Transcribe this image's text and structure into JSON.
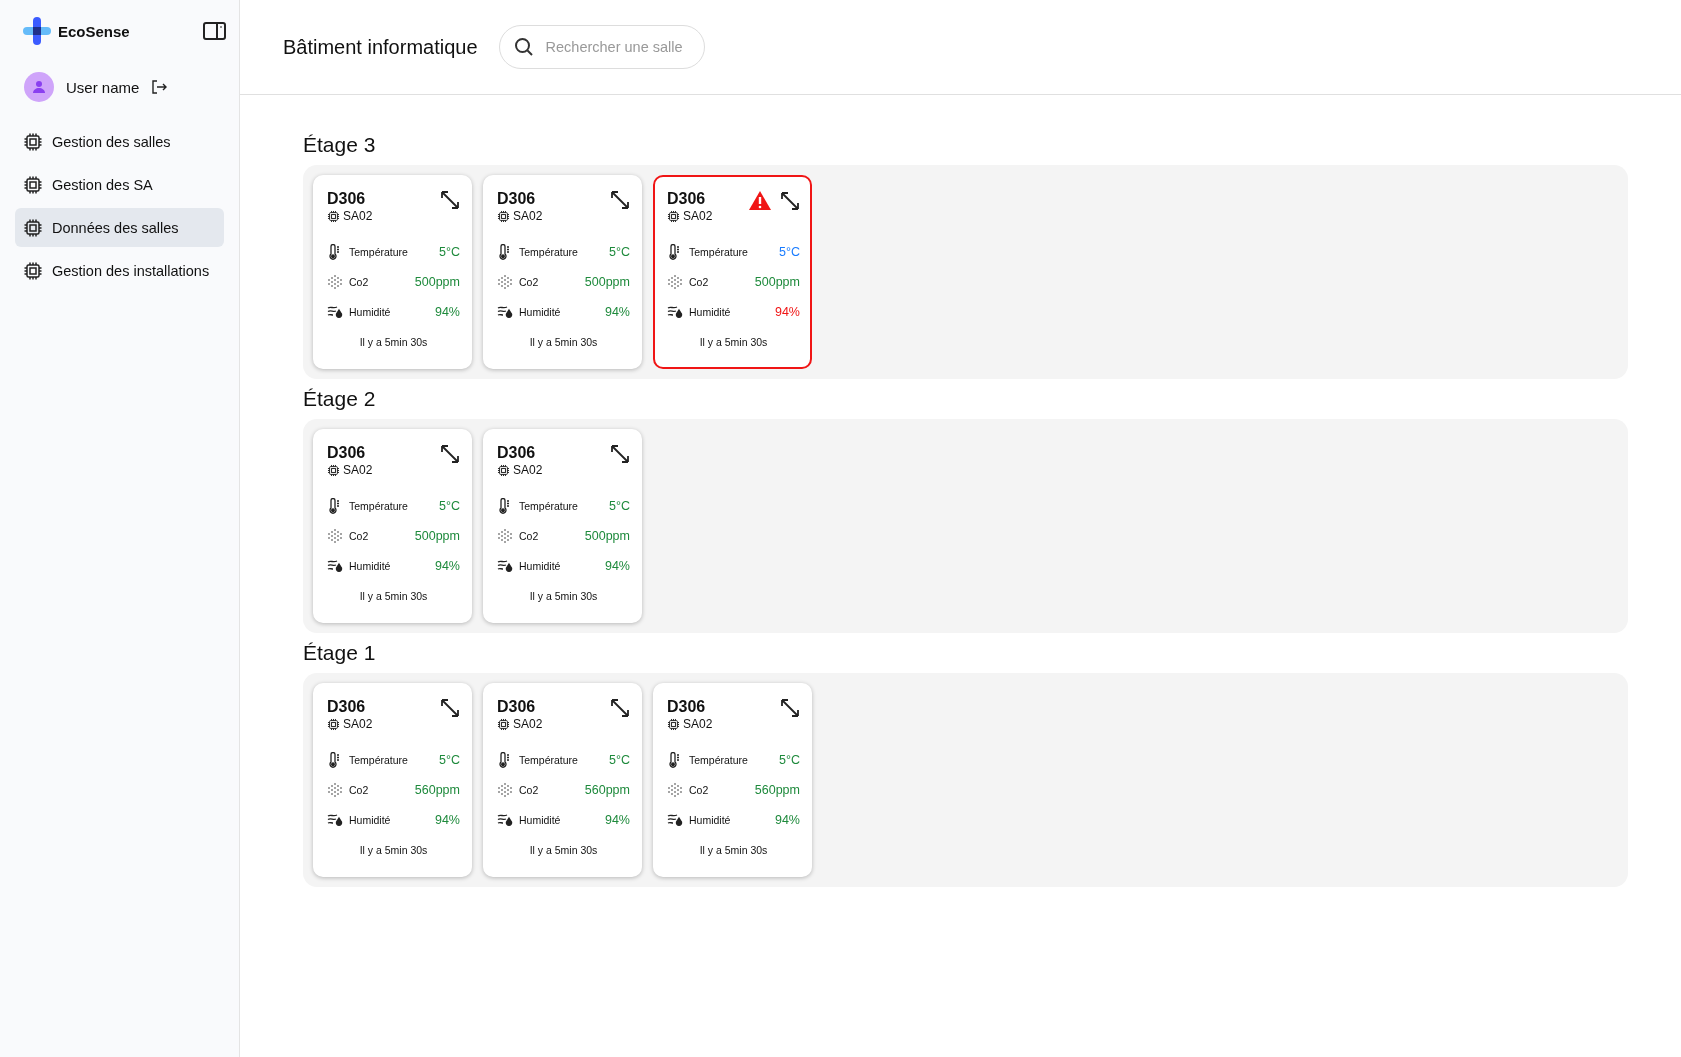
{
  "app": {
    "name": "EcoSense"
  },
  "user": {
    "name": "User name"
  },
  "nav": [
    {
      "label": "Gestion des salles",
      "selected": false
    },
    {
      "label": "Gestion des SA",
      "selected": false
    },
    {
      "label": "Données des salles",
      "selected": true
    },
    {
      "label": "Gestion des installations",
      "selected": false
    }
  ],
  "header": {
    "title": "Bâtiment informatique",
    "search": {
      "placeholder": "Rechercher une salle"
    }
  },
  "floors": [
    {
      "title": "Étage 3",
      "rooms": [
        {
          "name": "D306",
          "device": "SA02",
          "alert": false,
          "updated": "Il y a 5min 30s",
          "metrics": [
            {
              "kind": "temperature",
              "label": "Température",
              "value": "5°C",
              "color": "#1e8a3c"
            },
            {
              "kind": "co2",
              "label": "Co2",
              "value": "500ppm",
              "color": "#1e8a3c"
            },
            {
              "kind": "humidity",
              "label": "Humidité",
              "value": "94%",
              "color": "#1e8a3c"
            }
          ]
        },
        {
          "name": "D306",
          "device": "SA02",
          "alert": false,
          "updated": "Il y a 5min 30s",
          "metrics": [
            {
              "kind": "temperature",
              "label": "Température",
              "value": "5°C",
              "color": "#1e8a3c"
            },
            {
              "kind": "co2",
              "label": "Co2",
              "value": "500ppm",
              "color": "#1e8a3c"
            },
            {
              "kind": "humidity",
              "label": "Humidité",
              "value": "94%",
              "color": "#1e8a3c"
            }
          ]
        },
        {
          "name": "D306",
          "device": "SA02",
          "alert": true,
          "updated": "Il y a 5min 30s",
          "metrics": [
            {
              "kind": "temperature",
              "label": "Température",
              "value": "5°C",
              "color": "#1a7cff"
            },
            {
              "kind": "co2",
              "label": "Co2",
              "value": "500ppm",
              "color": "#1e8a3c"
            },
            {
              "kind": "humidity",
              "label": "Humidité",
              "value": "94%",
              "color": "#f01515"
            }
          ]
        }
      ]
    },
    {
      "title": "Étage 2",
      "rooms": [
        {
          "name": "D306",
          "device": "SA02",
          "alert": false,
          "updated": "Il y a 5min 30s",
          "metrics": [
            {
              "kind": "temperature",
              "label": "Température",
              "value": "5°C",
              "color": "#1e8a3c"
            },
            {
              "kind": "co2",
              "label": "Co2",
              "value": "500ppm",
              "color": "#1e8a3c"
            },
            {
              "kind": "humidity",
              "label": "Humidité",
              "value": "94%",
              "color": "#1e8a3c"
            }
          ]
        },
        {
          "name": "D306",
          "device": "SA02",
          "alert": false,
          "updated": "Il y a 5min 30s",
          "metrics": [
            {
              "kind": "temperature",
              "label": "Température",
              "value": "5°C",
              "color": "#1e8a3c"
            },
            {
              "kind": "co2",
              "label": "Co2",
              "value": "500ppm",
              "color": "#1e8a3c"
            },
            {
              "kind": "humidity",
              "label": "Humidité",
              "value": "94%",
              "color": "#1e8a3c"
            }
          ]
        }
      ]
    },
    {
      "title": "Étage 1",
      "rooms": [
        {
          "name": "D306",
          "device": "SA02",
          "alert": false,
          "updated": "Il y a 5min 30s",
          "metrics": [
            {
              "kind": "temperature",
              "label": "Température",
              "value": "5°C",
              "color": "#1e8a3c"
            },
            {
              "kind": "co2",
              "label": "Co2",
              "value": "560ppm",
              "color": "#1e8a3c"
            },
            {
              "kind": "humidity",
              "label": "Humidité",
              "value": "94%",
              "color": "#1e8a3c"
            }
          ]
        },
        {
          "name": "D306",
          "device": "SA02",
          "alert": false,
          "updated": "Il y a 5min 30s",
          "metrics": [
            {
              "kind": "temperature",
              "label": "Température",
              "value": "5°C",
              "color": "#1e8a3c"
            },
            {
              "kind": "co2",
              "label": "Co2",
              "value": "560ppm",
              "color": "#1e8a3c"
            },
            {
              "kind": "humidity",
              "label": "Humidité",
              "value": "94%",
              "color": "#1e8a3c"
            }
          ]
        },
        {
          "name": "D306",
          "device": "SA02",
          "alert": false,
          "updated": "Il y a 5min 30s",
          "metrics": [
            {
              "kind": "temperature",
              "label": "Température",
              "value": "5°C",
              "color": "#1e8a3c"
            },
            {
              "kind": "co2",
              "label": "Co2",
              "value": "560ppm",
              "color": "#1e8a3c"
            },
            {
              "kind": "humidity",
              "label": "Humidité",
              "value": "94%",
              "color": "#1e8a3c"
            }
          ]
        }
      ]
    }
  ]
}
